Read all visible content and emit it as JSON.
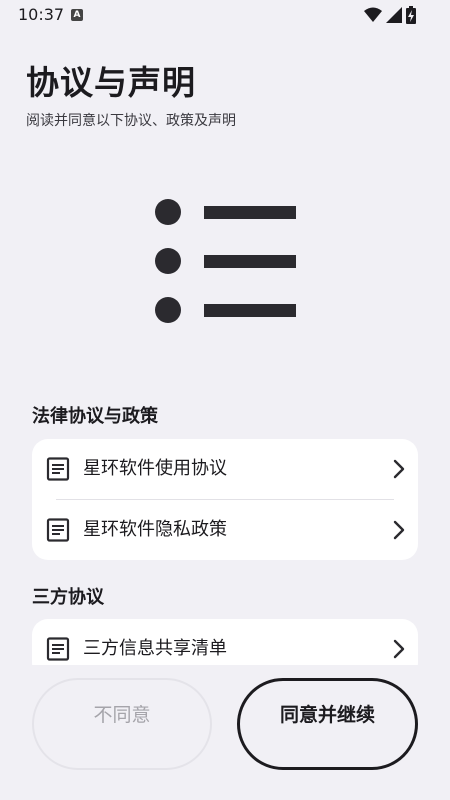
{
  "status_bar": {
    "time": "10:37",
    "a_badge": "A",
    "icons": [
      "wifi-icon",
      "cell-signal-icon",
      "battery-charging-icon"
    ]
  },
  "header": {
    "title": "协议与声明",
    "subtitle": "阅读并同意以下协议、政策及声明"
  },
  "illustration": {
    "icon": "list-bullets-icon"
  },
  "sections": [
    {
      "title": "法律协议与政策",
      "items": [
        {
          "label": "星环软件使用协议",
          "icon": "document-icon"
        },
        {
          "label": "星环软件隐私政策",
          "icon": "document-icon"
        }
      ]
    },
    {
      "title": "三方协议",
      "items": [
        {
          "label": "三方信息共享清单",
          "icon": "document-icon"
        }
      ]
    }
  ],
  "actions": {
    "disagree_label": "不同意",
    "agree_label": "同意并继续"
  },
  "colors": {
    "background": "#f1f0f5",
    "card": "#ffffff",
    "text": "#1c1b1f",
    "disabled_text": "#a5a4aa"
  }
}
